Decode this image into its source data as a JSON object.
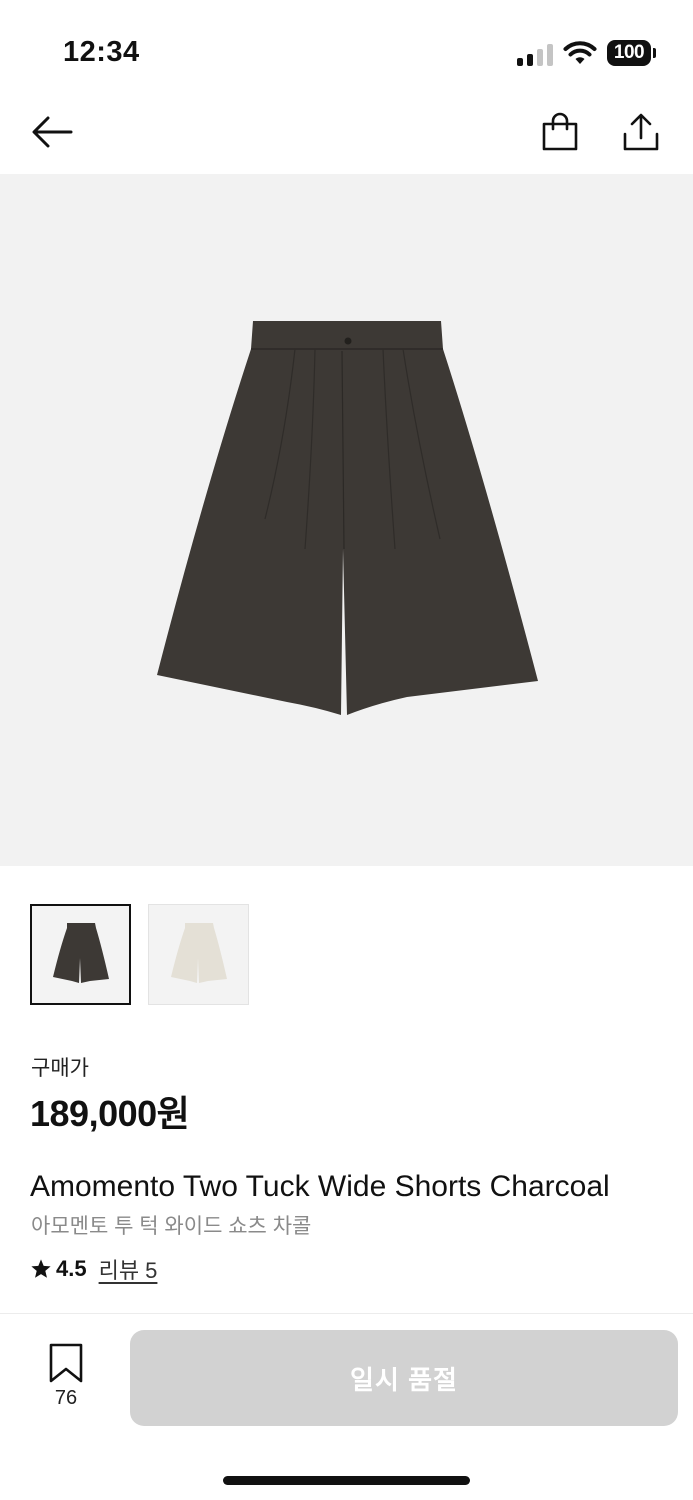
{
  "status_bar": {
    "time": "12:34",
    "battery": "100"
  },
  "product": {
    "price_label": "구매가",
    "price": "189,000원",
    "name_en": "Amomento Two Tuck Wide Shorts Charcoal",
    "name_ko": "아모멘토 투 턱 와이드 쇼츠 차콜",
    "rating": "4.5",
    "review_link": "리뷰 5",
    "colors": {
      "charcoal": "#3d3935",
      "ivory": "#e4e0d6"
    }
  },
  "icons": {
    "back": "arrow-left-icon",
    "bag": "shopping-bag-icon",
    "share": "share-icon",
    "star": "star-icon",
    "bookmark": "bookmark-icon"
  },
  "bottom_bar": {
    "bookmark_count": "76",
    "cta_label": "일시 품절",
    "cta_color": "#d2d2d2"
  }
}
